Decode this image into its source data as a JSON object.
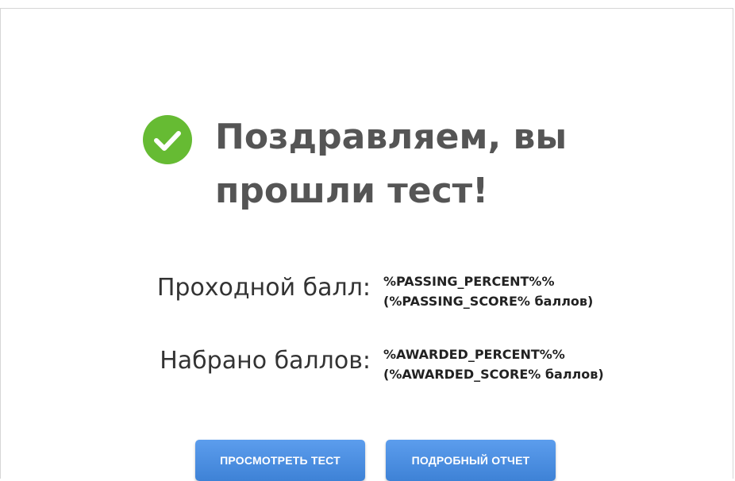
{
  "result": {
    "title": "Поздравляем, вы прошли тест!",
    "status_icon": "check-circle-icon",
    "success_color": "#66bb33"
  },
  "scores": {
    "passing": {
      "label": "Проходной балл:",
      "percent": "%PASSING_PERCENT%%",
      "score": "(%PASSING_SCORE% баллов)"
    },
    "awarded": {
      "label": "Набрано баллов:",
      "percent": "%AWARDED_PERCENT%%",
      "score": "(%AWARDED_SCORE% баллов)"
    }
  },
  "actions": {
    "review_label": "ПРОСМОТРЕТЬ ТЕСТ",
    "report_label": "ПОДРОБНЫЙ ОТЧЕТ",
    "button_color": "#4a8fe0"
  }
}
